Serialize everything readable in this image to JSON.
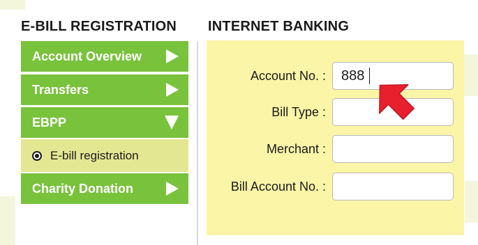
{
  "left_section": {
    "title": "E-BILL REGISTRATION",
    "menu": [
      {
        "label": "Account Overview",
        "arrow": "right"
      },
      {
        "label": "Transfers",
        "arrow": "right"
      },
      {
        "label": "EBPP",
        "arrow": "down"
      },
      {
        "label": "Charity Donation",
        "arrow": "right"
      }
    ],
    "submenu": {
      "label": "E-bill registration",
      "selected": true
    }
  },
  "right_section": {
    "title": "INTERNET BANKING",
    "fields": {
      "account_no": {
        "label": "Account No. :",
        "value": "888"
      },
      "bill_type": {
        "label": "Bill Type :",
        "value": ""
      },
      "merchant": {
        "label": "Merchant :",
        "value": ""
      },
      "bill_account_no": {
        "label": "Bill Account No. :",
        "value": ""
      }
    }
  },
  "colors": {
    "menu_green": "#79c23c",
    "submenu_yellow": "#e3e792",
    "panel_yellow": "#fbf5a7",
    "pointer_red": "#e8202e"
  },
  "icons": {
    "pointer": "red-arrow-pointer-icon"
  }
}
